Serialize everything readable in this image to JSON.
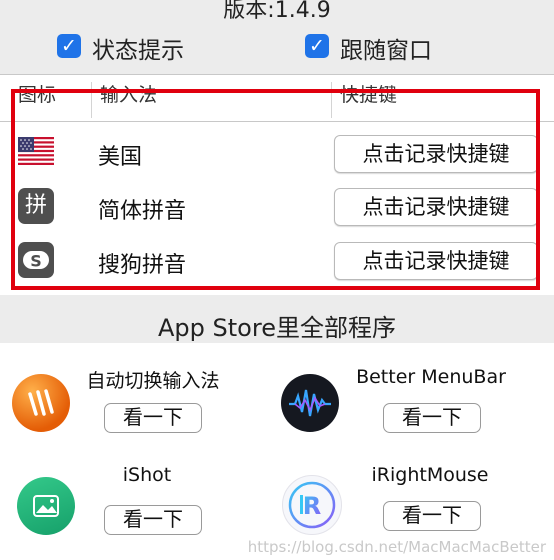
{
  "version_label": "版本:1.4.9",
  "options": [
    {
      "label": "状态提示",
      "checked": true
    },
    {
      "label": "跟随窗口",
      "checked": true
    }
  ],
  "table": {
    "headers": [
      "图标",
      "输入法",
      "快捷键"
    ],
    "rows": [
      {
        "icon": "us-flag-icon",
        "name": "美国",
        "shortcut": "点击记录快捷键"
      },
      {
        "icon": "pinyin-icon",
        "icon_text": "拼",
        "name": "简体拼音",
        "shortcut": "点击记录快捷键"
      },
      {
        "icon": "sogou-icon",
        "icon_text": "S",
        "name": "搜狗拼音",
        "shortcut": "点击记录快捷键"
      }
    ]
  },
  "store": {
    "title": "App Store里全部程序",
    "apps": [
      {
        "name": "自动切换输入法",
        "button": "看一下",
        "icon": "auto-switch-icon"
      },
      {
        "name": "Better MenuBar",
        "button": "看一下",
        "icon": "better-menubar-icon"
      },
      {
        "name": "iShot",
        "button": "看一下",
        "icon": "ishot-icon"
      },
      {
        "name": "iRightMouse",
        "button": "看一下",
        "icon": "irightmouse-icon"
      }
    ]
  },
  "watermark": "https://blog.csdn.net/MacMacMacBetter",
  "colors": {
    "accent": "#1f73e8",
    "highlight_border": "#e0000e"
  }
}
